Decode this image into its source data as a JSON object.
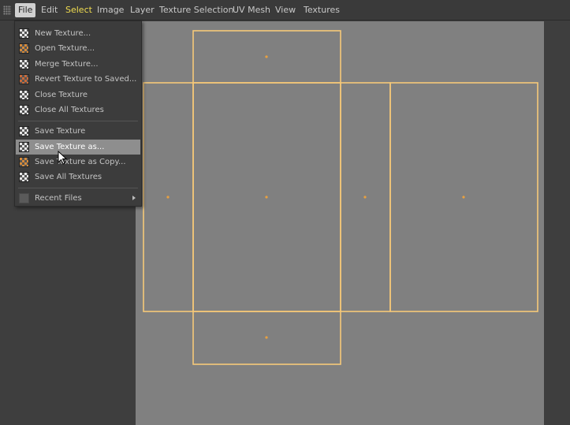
{
  "menubar": {
    "items": [
      {
        "label": "File",
        "active": true
      },
      {
        "label": "Edit"
      },
      {
        "label": "Select",
        "accent": true
      },
      {
        "label": "Image"
      },
      {
        "label": "Layer"
      },
      {
        "label": "Texture Selection"
      },
      {
        "label": "UV Mesh"
      },
      {
        "label": "View"
      },
      {
        "label": "Textures"
      }
    ]
  },
  "file_menu": {
    "items": [
      {
        "label": "New Texture...",
        "icon": "new-texture-icon"
      },
      {
        "label": "Open Texture...",
        "icon": "open-texture-icon"
      },
      {
        "label": "Merge Texture...",
        "icon": "merge-texture-icon"
      },
      {
        "label": "Revert Texture to Saved...",
        "icon": "revert-texture-icon"
      },
      {
        "label": "Close Texture",
        "icon": "close-texture-icon"
      },
      {
        "label": "Close All Textures",
        "icon": "close-all-textures-icon"
      },
      {
        "label": "Save Texture",
        "icon": "save-texture-icon"
      },
      {
        "label": "Save Texture as...",
        "icon": "save-texture-as-icon",
        "highlighted": true
      },
      {
        "label": "Save Texture as Copy...",
        "icon": "save-texture-copy-icon"
      },
      {
        "label": "Save All Textures",
        "icon": "save-all-textures-icon"
      },
      {
        "label": "Recent Files",
        "icon": "recent-files-icon",
        "submenu": true
      }
    ]
  },
  "colors": {
    "uv_edge": "#f5c878",
    "uv_center": "#e8a040",
    "viewport_bg": "#808080",
    "menu_accent": "#f0dc50"
  }
}
